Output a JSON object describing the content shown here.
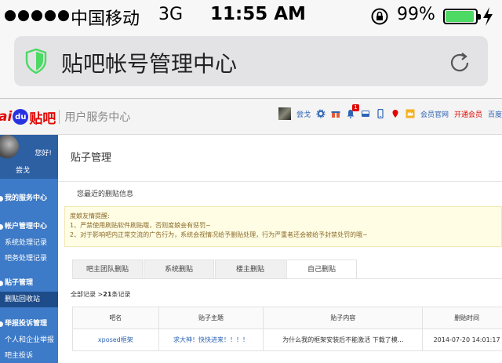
{
  "status_bar": {
    "carrier": "中国移动",
    "network": "3G",
    "time": "11:55 AM",
    "battery": "99%",
    "battery_color": "#4cd964"
  },
  "address_bar": {
    "title": "贴吧帐号管理中心",
    "shield_color": "#4cd964"
  },
  "header": {
    "logo_ai": "ai",
    "logo_du": "du",
    "logo_tieba": "贴吧",
    "logo_sub": "用户服务中心",
    "username": "尝戈",
    "notification_badge": "1",
    "vip_label": "会员官网",
    "open_vip_label": "开通会员",
    "baidu_label": "百度"
  },
  "sidebar": {
    "hello": "您好!",
    "username": "尝戈",
    "sections": [
      {
        "label": "我的服务中心",
        "items": []
      },
      {
        "label": "帐户管理中心",
        "items": [
          "系统处理记录",
          "吧务处理记录"
        ]
      },
      {
        "label": "贴子管理",
        "items": [
          "删贴回收站"
        ]
      },
      {
        "label": "举报投诉管理",
        "items": [
          "个人和企业举报",
          "吧主投诉"
        ]
      }
    ]
  },
  "main": {
    "title": "贴子管理",
    "recent_label": "您最近的删贴信息",
    "notice": {
      "heading": "度娘友情提醒:",
      "line1": "1、严禁使用刷贴软件刷贴哦，否则度娘会有惩罚~",
      "line2": "2、对于影响吧内正常交流的广告行为，系统会视情况给予删贴处理，行为严重者还会被给予封禁处罚的哦~"
    },
    "tabs": [
      "吧主团队删贴",
      "系统删贴",
      "楼主删贴",
      "自己删贴"
    ],
    "active_tab": 3,
    "count_prefix": "全部记录 >",
    "count_value": "21",
    "count_suffix": "条记录",
    "table": {
      "headers": [
        "吧名",
        "贴子主题",
        "贴子内容",
        "删贴时间"
      ],
      "rows": [
        [
          "xposed框架",
          "求大神！快快进来！！！！",
          "为什么我的框架安装后不能激活 下载了模...",
          "2014-07-20 14:01:17"
        ]
      ]
    }
  }
}
